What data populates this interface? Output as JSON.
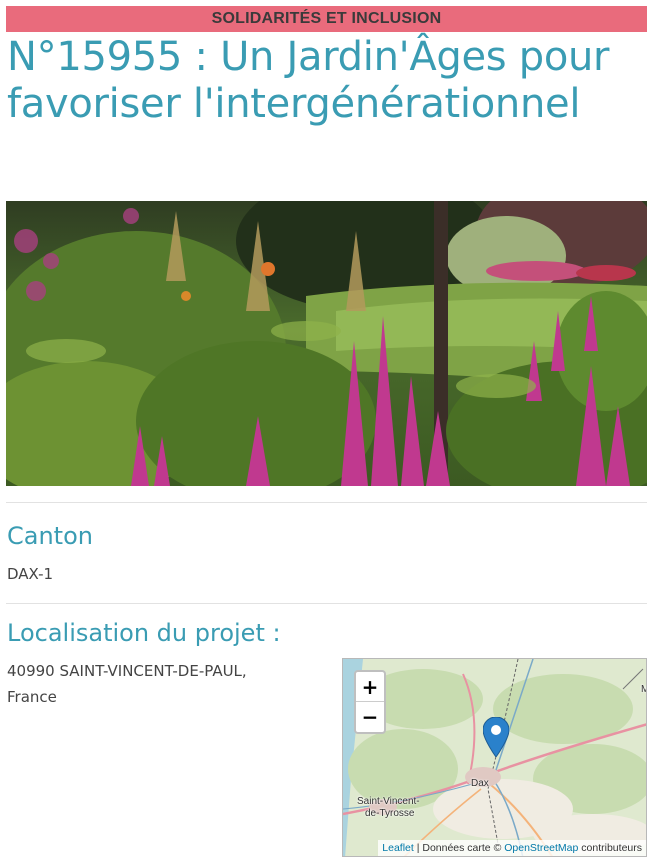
{
  "category": "SOLIDARITÉS ET INCLUSION",
  "title": "N°15955 : Un Jardin'Âges pour favoriser l'intergénérationnel",
  "hero": {
    "alt": "Jardin fleuri avec astilbes roses"
  },
  "canton": {
    "heading": "Canton",
    "value": "DAX-1"
  },
  "location": {
    "heading": "Localisation du projet :",
    "address_line1": "40990 SAINT-VINCENT-DE-PAUL,",
    "address_line2": "France"
  },
  "map": {
    "zoom_in": "+",
    "zoom_out": "−",
    "labels": {
      "city": "Dax",
      "town_line1": "Saint-Vincent-",
      "town_line2": "de-Tyrosse",
      "edge_letter": "M"
    },
    "attribution": {
      "leaflet": "Leaflet",
      "separator": " | Données carte © ",
      "osm": "OpenStreetMap",
      "suffix": " contributeurs"
    }
  },
  "colors": {
    "accent": "#3a9cb3",
    "banner": "#e96b7c"
  }
}
